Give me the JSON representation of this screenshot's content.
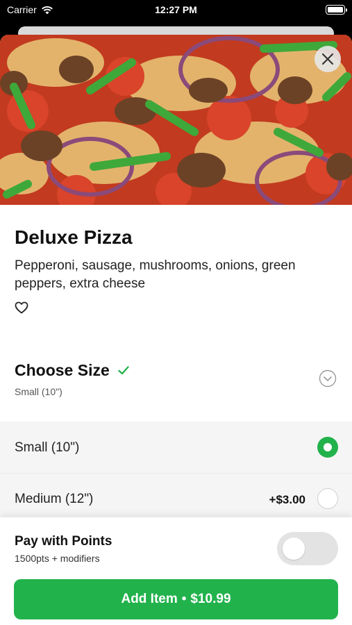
{
  "status_bar": {
    "carrier": "Carrier",
    "time": "12:27 PM",
    "icons": [
      "wifi-icon",
      "battery-icon"
    ]
  },
  "hero": {
    "image_icon": "pizza-photo"
  },
  "close": {
    "icon": "close-icon"
  },
  "item": {
    "title": "Deluxe Pizza",
    "description": "Pepperoni, sausage, mushrooms, onions, green peppers, extra cheese",
    "favorite_icon": "heart-icon"
  },
  "size_section": {
    "title": "Choose Size",
    "check_icon": "checkmark-icon",
    "selected": "Small (10\")",
    "collapse_icon": "chevron-down-icon",
    "options": [
      {
        "label": "Small (10\")",
        "price": "",
        "selected": true
      },
      {
        "label": "Medium (12\")",
        "price": "+$3.00",
        "selected": false
      }
    ]
  },
  "points": {
    "title": "Pay with Points",
    "subtitle": "1500pts + modifiers",
    "enabled": false
  },
  "add_button": {
    "label": "Add Item",
    "separator": "•",
    "price": "$10.99"
  },
  "colors": {
    "accent": "#22b24c",
    "check": "#22b24c"
  }
}
